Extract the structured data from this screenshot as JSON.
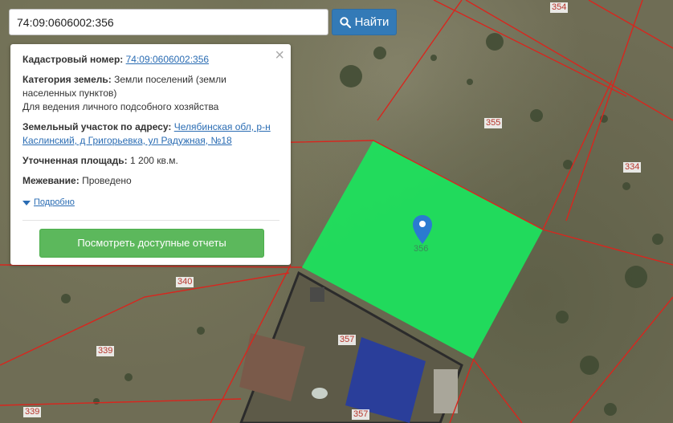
{
  "search": {
    "value": "74:09:0606002:356",
    "button_label": "Найти"
  },
  "panel": {
    "cadastral_label": "Кадастровый номер:",
    "cadastral_value": "74:09:0606002:356",
    "category_label": "Категория земель:",
    "category_value": "Земли поселений (земли населенных пунктов)",
    "usage": "Для ведения личного подсобного хозяйства",
    "address_label": "Земельный участок по адресу:",
    "address_value": "Челябинская обл, р-н Каслинский, д Григорьевка, ул Радужная, №18",
    "area_label": "Уточненная площадь:",
    "area_value": "1 200 кв.м.",
    "survey_label": "Межевание:",
    "survey_value": "Проведено",
    "more_label": "Подробно",
    "reports_button": "Посмотреть доступные отчеты",
    "close_symbol": "×"
  },
  "map": {
    "plot_labels": [
      "354",
      "355",
      "334",
      "340",
      "339",
      "357",
      "357",
      "339"
    ],
    "selected_plot": "356",
    "colors": {
      "selected_fill": "#1ee05d",
      "boundary": "#d8261e",
      "pin": "#2a7bd0"
    }
  }
}
